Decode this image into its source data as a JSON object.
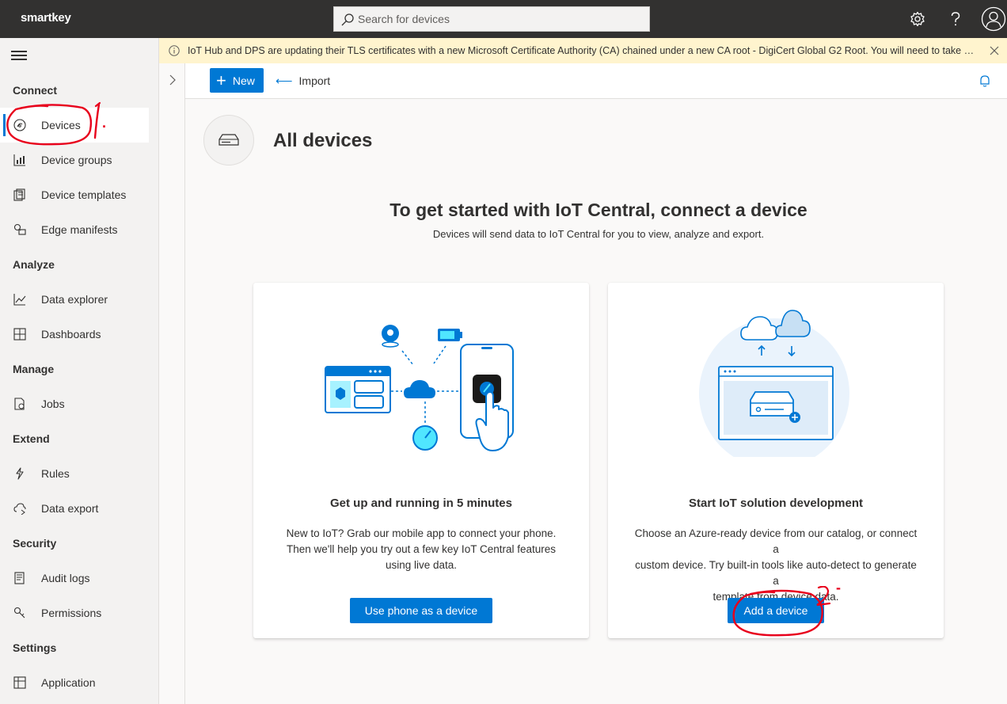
{
  "app": {
    "brand": "smartkey"
  },
  "search": {
    "placeholder": "Search for devices"
  },
  "topbar_icons": [
    "gear-icon",
    "help-icon",
    "account-icon"
  ],
  "banner": {
    "text": "IoT Hub and DPS are updating their TLS certificates with a new Microsoft Certificate Authority (CA) chained under a new CA root - DigiCert Global G2 Root. You will need to take action to e..."
  },
  "sidebar": {
    "sections": [
      {
        "heading": "Connect",
        "items": [
          {
            "label": "Devices",
            "icon": "devices-icon",
            "selected": true
          },
          {
            "label": "Device groups",
            "icon": "device-groups-icon"
          },
          {
            "label": "Device templates",
            "icon": "device-templates-icon"
          },
          {
            "label": "Edge manifests",
            "icon": "edge-manifests-icon"
          }
        ]
      },
      {
        "heading": "Analyze",
        "items": [
          {
            "label": "Data explorer",
            "icon": "data-explorer-icon"
          },
          {
            "label": "Dashboards",
            "icon": "dashboards-icon"
          }
        ]
      },
      {
        "heading": "Manage",
        "items": [
          {
            "label": "Jobs",
            "icon": "jobs-icon"
          }
        ]
      },
      {
        "heading": "Extend",
        "items": [
          {
            "label": "Rules",
            "icon": "rules-icon"
          },
          {
            "label": "Data export",
            "icon": "data-export-icon"
          }
        ]
      },
      {
        "heading": "Security",
        "items": [
          {
            "label": "Audit logs",
            "icon": "audit-logs-icon"
          },
          {
            "label": "Permissions",
            "icon": "permissions-icon"
          }
        ]
      },
      {
        "heading": "Settings",
        "items": [
          {
            "label": "Application",
            "icon": "application-icon"
          }
        ]
      }
    ]
  },
  "commandbar": {
    "new_label": "New",
    "import_label": "Import"
  },
  "page": {
    "title": "All devices"
  },
  "hero": {
    "title": "To get started with IoT Central, connect a device",
    "subtitle": "Devices will send data to IoT Central for you to view, analyze and export."
  },
  "cards": [
    {
      "title": "Get up and running in 5 minutes",
      "desc_lines": [
        "New to IoT? Grab our mobile app to connect your phone.",
        "Then we'll help you try out a few key IoT Central features",
        "using live data."
      ],
      "button": "Use phone as a device"
    },
    {
      "title": "Start IoT solution development",
      "desc_lines": [
        "Choose an Azure-ready device from our catalog, or connect a",
        "custom device. Try built-in tools like auto-detect to generate a",
        "template from device data."
      ],
      "button": "Add a device"
    }
  ],
  "annotations": {
    "mark1": "1.",
    "mark2": "2."
  },
  "colors": {
    "accent": "#0078d4",
    "topbar": "#323130",
    "banner": "#fff4ce",
    "annotation": "#e8001c"
  }
}
